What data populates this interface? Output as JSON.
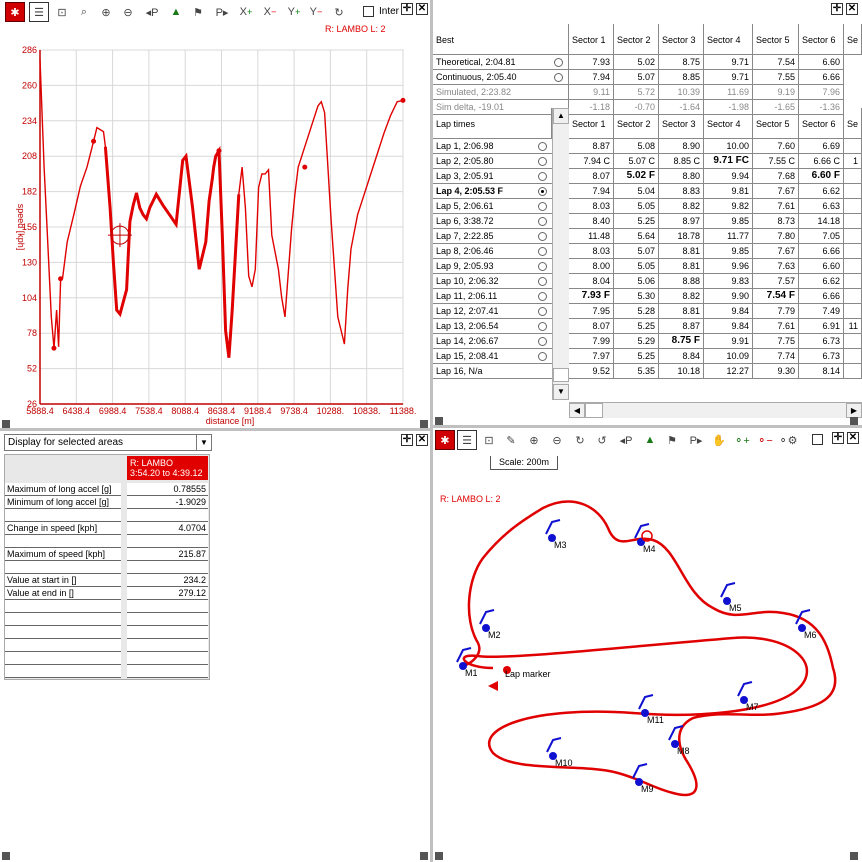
{
  "chart": {
    "legend": "R: LAMBO  L: 2",
    "ylabel": "speed [kph]",
    "xlabel": "distance [m]",
    "yticks": [
      "286",
      "260",
      "234",
      "208",
      "182",
      "156",
      "130",
      "104",
      "78",
      "52",
      "26"
    ],
    "xticks": [
      "5888.4",
      "6438.4",
      "6988.4",
      "7538.4",
      "8088.4",
      "8638.4",
      "9188.4",
      "9738.4",
      "10288.",
      "10838.",
      "11388."
    ],
    "toolbar_check_label": "Inter",
    "colors": {
      "trace": "#e00000",
      "grid": "#d8d8d8",
      "axis": "#c00000"
    }
  },
  "chart_data": {
    "type": "line",
    "title": "",
    "xlabel": "distance [m]",
    "ylabel": "speed [kph]",
    "xlim": [
      5888.4,
      11388.4
    ],
    "ylim": [
      26,
      286
    ],
    "grid": true,
    "series": [
      {
        "name": "R: LAMBO L: 2",
        "x": [
          5888.4,
          5950,
          6000,
          6060,
          6100,
          6140,
          6170,
          6200,
          6230,
          6300,
          6400,
          6500,
          6600,
          6700,
          6750,
          6850,
          6880,
          6950,
          7000,
          7050,
          7100,
          7200,
          7250,
          7300,
          7350,
          7400,
          7450,
          7500,
          7550,
          7650,
          7750,
          7850,
          7950,
          8050,
          8100,
          8200,
          8300,
          8400,
          8450,
          8500,
          8520,
          8550,
          8600,
          8650,
          8700,
          8750,
          8800,
          8900,
          8950,
          9000,
          9050,
          9100,
          9150,
          9200,
          9250,
          9300,
          9350,
          9400,
          9500,
          9550,
          9600,
          9700,
          9750,
          9800,
          9900,
          10000,
          10100,
          10150,
          10200,
          10300,
          10400,
          10500,
          10550,
          10600,
          10700,
          10800,
          10900,
          11000,
          11100,
          11200,
          11300,
          11388
        ],
        "y": [
          279,
          200,
          150,
          90,
          67,
          95,
          68,
          117,
          118,
          145,
          165,
          186,
          200,
          219,
          229,
          226,
          215,
          170,
          130,
          95,
          92,
          110,
          160,
          172,
          181,
          170,
          165,
          162,
          170,
          180,
          172,
          165,
          158,
          205,
          208,
          170,
          125,
          145,
          175,
          192,
          200,
          208,
          212,
          150,
          80,
          60,
          95,
          180,
          200,
          170,
          120,
          112,
          125,
          185,
          195,
          195,
          198,
          150,
          125,
          104,
          90,
          155,
          180,
          200,
          215,
          230,
          245,
          248,
          240,
          160,
          90,
          70,
          110,
          140,
          165,
          180,
          195,
          210,
          225,
          238,
          248,
          249
        ]
      }
    ]
  },
  "best": {
    "header": "Best",
    "sectors": [
      "Sector 1",
      "Sector 2",
      "Sector 3",
      "Sector 4",
      "Sector 5",
      "Sector 6",
      "Se"
    ],
    "rows": [
      {
        "label": "Theoretical,  2:04.81",
        "vals": [
          "7.93",
          "5.02",
          "8.75",
          "9.71",
          "7.54",
          "6.60"
        ]
      },
      {
        "label": "Continuous,  2:05.40",
        "vals": [
          "7.94",
          "5.07",
          "8.85",
          "9.71",
          "7.55",
          "6.66"
        ]
      },
      {
        "label": "Simulated,  2:23.82",
        "vals": [
          "9.11",
          "5.72",
          "10.39",
          "11.69",
          "9.19",
          "7.96"
        ]
      },
      {
        "label": "Sim delta, -19.01",
        "vals": [
          "-1.18",
          "-0.70",
          "-1.64",
          "-1.98",
          "-1.65",
          "-1.36"
        ]
      }
    ]
  },
  "laps": {
    "header": "Lap times",
    "sectors": [
      "Sector 1",
      "Sector 2",
      "Sector 3",
      "Sector 4",
      "Sector 5",
      "Sector 6",
      "Se"
    ],
    "rows": [
      {
        "label": "Lap 1,  2:06.98",
        "vals": [
          "8.87",
          "5.08",
          "8.90",
          "10.00",
          "7.60",
          "6.69",
          ""
        ]
      },
      {
        "label": "Lap 2,  2:05.80",
        "vals": [
          "7.94 C",
          "5.07 C",
          "8.85 C",
          "9.71 FC",
          "7.55 C",
          "6.66 C",
          "1"
        ]
      },
      {
        "label": "Lap 3,  2:05.91",
        "vals": [
          "8.07",
          "5.02 F",
          "8.80",
          "9.94",
          "7.68",
          "6.60 F",
          ""
        ]
      },
      {
        "label": "Lap 4,  2:05.53 F",
        "vals": [
          "7.94",
          "5.04",
          "8.83",
          "9.81",
          "7.67",
          "6.62",
          ""
        ]
      },
      {
        "label": "Lap 5,  2:06.61",
        "vals": [
          "8.03",
          "5.05",
          "8.82",
          "9.82",
          "7.61",
          "6.63",
          ""
        ]
      },
      {
        "label": "Lap 6,  3:38.72",
        "vals": [
          "8.40",
          "5.25",
          "8.97",
          "9.85",
          "8.73",
          "14.18",
          ""
        ]
      },
      {
        "label": "Lap 7,  2:22.85",
        "vals": [
          "11.48",
          "5.64",
          "18.78",
          "11.77",
          "7.80",
          "7.05",
          ""
        ]
      },
      {
        "label": "Lap 8,  2:06.46",
        "vals": [
          "8.03",
          "5.07",
          "8.81",
          "9.85",
          "7.67",
          "6.66",
          ""
        ]
      },
      {
        "label": "Lap 9,  2:05.93",
        "vals": [
          "8.00",
          "5.05",
          "8.81",
          "9.96",
          "7.63",
          "6.60",
          ""
        ]
      },
      {
        "label": "Lap 10,  2:06.32",
        "vals": [
          "8.04",
          "5.06",
          "8.88",
          "9.83",
          "7.57",
          "6.62",
          ""
        ]
      },
      {
        "label": "Lap 11,  2:06.11",
        "vals": [
          "7.93 F",
          "5.30",
          "8.82",
          "9.90",
          "7.54 F",
          "6.66",
          ""
        ]
      },
      {
        "label": "Lap 12,  2:07.41",
        "vals": [
          "7.95",
          "5.28",
          "8.81",
          "9.84",
          "7.79",
          "7.49",
          ""
        ]
      },
      {
        "label": "Lap 13,  2:06.54",
        "vals": [
          "8.07",
          "5.25",
          "8.87",
          "9.84",
          "7.61",
          "6.91",
          "11"
        ]
      },
      {
        "label": "Lap 14,  2:06.67",
        "vals": [
          "7.99",
          "5.29",
          "8.75 F",
          "9.91",
          "7.75",
          "6.73",
          ""
        ]
      },
      {
        "label": "Lap 15,  2:08.41",
        "vals": [
          "7.97",
          "5.25",
          "8.84",
          "10.09",
          "7.74",
          "6.73",
          ""
        ]
      },
      {
        "label": "Lap 16, N/a",
        "vals": [
          "9.52",
          "5.35",
          "10.18",
          "12.27",
          "9.30",
          "8.14",
          ""
        ]
      }
    ],
    "selected_index": 3
  },
  "stats": {
    "dropdown": "Display for selected areas",
    "col_header_line1": "R:  LAMBO",
    "col_header_line2": "3:54.20 to 4:39.12",
    "rows": [
      {
        "label": "Maximum of long accel [g]",
        "value": "0.78555"
      },
      {
        "label": "Minimum of long accel [g]",
        "value": "-1.9029"
      },
      {
        "label": "",
        "value": ""
      },
      {
        "label": "Change in speed [kph]",
        "value": "4.0704"
      },
      {
        "label": "",
        "value": ""
      },
      {
        "label": "Maximum of speed [kph]",
        "value": "215.87"
      },
      {
        "label": "",
        "value": ""
      },
      {
        "label": "Value at start in  []",
        "value": "234.2"
      },
      {
        "label": "Value at end in  []",
        "value": "279.12"
      },
      {
        "label": "",
        "value": ""
      },
      {
        "label": "",
        "value": ""
      },
      {
        "label": "",
        "value": ""
      },
      {
        "label": "",
        "value": ""
      },
      {
        "label": "",
        "value": ""
      },
      {
        "label": "",
        "value": ""
      }
    ]
  },
  "map": {
    "scale": "Scale: 200m",
    "legend": "R: LAMBO  L: 2",
    "lap_marker": "Lap marker",
    "markers": [
      "M1",
      "M2",
      "M3",
      "M4",
      "M5",
      "M6",
      "M7",
      "M8",
      "M9",
      "M10",
      "M11"
    ]
  }
}
